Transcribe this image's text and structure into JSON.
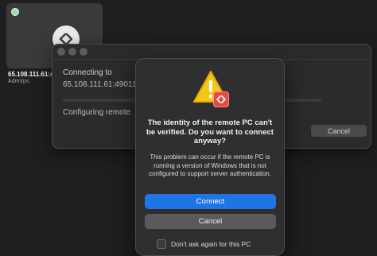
{
  "pc": {
    "name": "65.108.111.61:4",
    "user": "AdmVps"
  },
  "connecting_window": {
    "title": "Connecting to",
    "address": "65.108.111.61:49011",
    "status": "Configuring remote",
    "cancel_label": "Cancel"
  },
  "alert": {
    "title": "The identity of the remote PC can't be verified. Do you want to connect anyway?",
    "message": "This problem can occur if the remote PC is running a version of Windows that is not configured to support server authentication.",
    "connect_label": "Connect",
    "cancel_label": "Cancel",
    "dont_ask_label": "Don't ask again for this PC",
    "dont_ask_checked": false,
    "icons": [
      "warning-icon",
      "remote-desktop-icon"
    ]
  },
  "colors": {
    "accent": "#1f74e6",
    "warning": "#f5c518",
    "badge": "#e94a3f"
  }
}
